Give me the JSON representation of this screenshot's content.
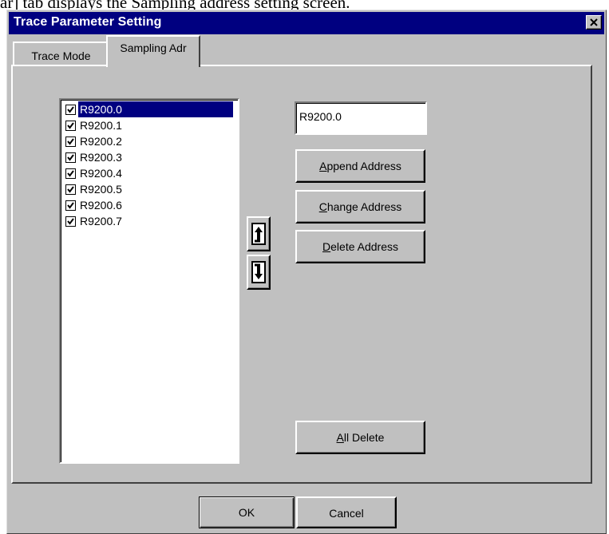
{
  "caption": "ar] tab displays the Sampling address setting screen.",
  "window": {
    "title": "Trace Parameter Setting",
    "close_icon": "close-x-icon"
  },
  "tabs": [
    {
      "label": "Trace Mode",
      "selected": false
    },
    {
      "label": "Sampling Adr",
      "selected": true
    }
  ],
  "address_list": {
    "items": [
      {
        "label": "R9200.0",
        "checked": true,
        "selected": true
      },
      {
        "label": "R9200.1",
        "checked": true,
        "selected": false
      },
      {
        "label": "R9200.2",
        "checked": true,
        "selected": false
      },
      {
        "label": "R9200.3",
        "checked": true,
        "selected": false
      },
      {
        "label": "R9200.4",
        "checked": true,
        "selected": false
      },
      {
        "label": "R9200.5",
        "checked": true,
        "selected": false
      },
      {
        "label": "R9200.6",
        "checked": true,
        "selected": false
      },
      {
        "label": "R9200.7",
        "checked": true,
        "selected": false
      }
    ]
  },
  "move_buttons": {
    "up_icon": "move-up-arrow-icon",
    "down_icon": "move-down-arrow-icon"
  },
  "address_input": {
    "value": "R9200.0"
  },
  "buttons": {
    "append": {
      "mnemonic": "A",
      "rest": "ppend Address"
    },
    "change": {
      "mnemonic": "C",
      "rest": "hange Address"
    },
    "delete": {
      "mnemonic": "D",
      "rest": "elete Address"
    },
    "all_delete": {
      "mnemonic": "A",
      "rest": "ll Delete"
    },
    "ok": "OK",
    "cancel": "Cancel"
  },
  "colors": {
    "face": "#c0c0c0",
    "titlebar": "#000080",
    "selection": "#000080"
  }
}
